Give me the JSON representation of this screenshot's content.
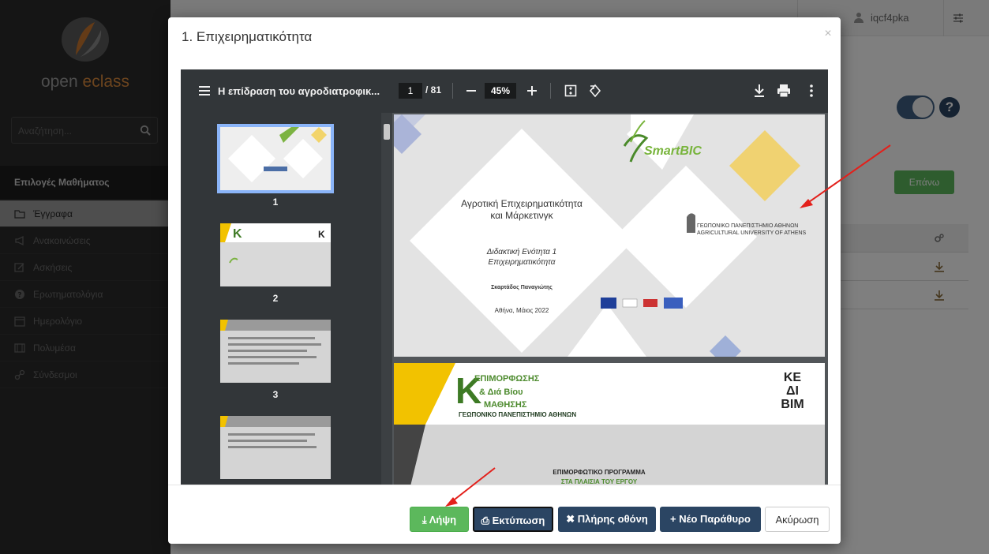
{
  "app": {
    "brand": "open eclass",
    "brand_prefix": "open ",
    "brand_accent": "eclass",
    "search_placeholder": "Αναζήτηση...",
    "user": "iqcf4pka"
  },
  "sidebar": {
    "header": "Επιλογές Μαθήματος",
    "items": [
      {
        "label": "Έγγραφα",
        "icon": "folder-icon",
        "active": true
      },
      {
        "label": "Ανακοινώσεις",
        "icon": "megaphone-icon"
      },
      {
        "label": "Ασκήσεις",
        "icon": "edit-icon"
      },
      {
        "label": "Ερωτηματολόγια",
        "icon": "question-icon"
      },
      {
        "label": "Ημερολόγιο",
        "icon": "calendar-icon"
      },
      {
        "label": "Πολυμέσα",
        "icon": "film-icon"
      },
      {
        "label": "Σύνδεσμοι",
        "icon": "link-icon"
      }
    ]
  },
  "background": {
    "up_button": "Επάνω"
  },
  "modal": {
    "title": "1. Επιχειρηματικότητα",
    "close": "×"
  },
  "viewer": {
    "doc_title": "Η επίδραση του αγροδιατροφικ...",
    "current_page": "1",
    "total_pages": "/ 81",
    "zoom": "45%",
    "minus": "—",
    "plus": "+",
    "thumb_numbers": [
      "1",
      "2",
      "3"
    ]
  },
  "page1": {
    "title_line1": "Αγροτική Επιχειρηματικότητα",
    "title_line2": "και Μάρκετινγκ",
    "sub_line1": "Διδακτική Ενότητα 1",
    "sub_line2": "Επιχειρηματικότητα",
    "author": "Σκαρτάδος Παναγιώτης",
    "date": "Αθήνα, Μάιος 2022",
    "univ_gr": "ΓΕΩΠΟΝΙΚΟ ΠΑΝΕΠΙΣΤΗΜΙΟ ΑΘΗΝΩΝ",
    "univ_en": "AGRICULTURAL UNIVERSITY OF ATHENS",
    "brand": "SmartBIC"
  },
  "page2": {
    "big_letter": "Κ",
    "line1": "ΕΠΙΜΟΡΦΩΣΗΣ",
    "line2": "& Διά Βίου",
    "line3": "ΜΑΘΗΣΗΣ",
    "line4": "ΓΕΩΠΟΝΙΚΟ ΠΑΝΕΠΙΣΤΗΜΙΟ ΑΘΗΝΩΝ",
    "program": "ΕΠΙΜΟΡΦΩΤΙΚΟ ΠΡΟΓΡΑΜΜΑ",
    "program2": "ΣΤΑ ΠΛΑΙΣΙΑ ΤΟΥ ΕΡΓΟΥ",
    "logo_line1": "ΚΕ",
    "logo_line2": "ΔΙ",
    "logo_line3": "ΒΙΜ"
  },
  "footer": {
    "download": "Λήψη",
    "print": "Εκτύπωση",
    "fullscreen": "Πλήρης οθόνη",
    "new_window": "Νέο Παράθυρο",
    "cancel": "Ακύρωση"
  },
  "colors": {
    "primary": "#2b4563",
    "success": "#5cb85c",
    "annotation_arrow": "#e3201b"
  }
}
